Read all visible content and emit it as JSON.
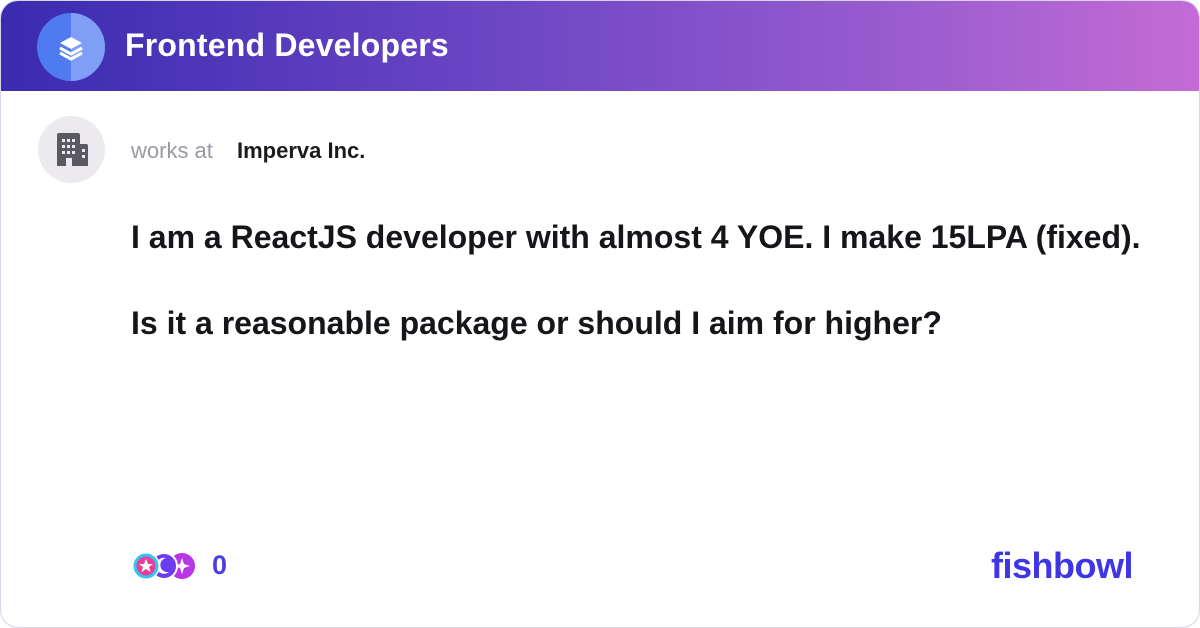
{
  "header": {
    "group_title": "Frontend Developers",
    "logo_icon": "layers-icon"
  },
  "author": {
    "avatar_icon": "building-icon",
    "works_at_label": "works at",
    "company": "Imperva Inc."
  },
  "post": {
    "line1": "I am a ReactJS developer with almost 4 YOE. I make 15LPA (fixed).",
    "line2": "Is it a reasonable package or should I aim for higher?"
  },
  "footer": {
    "reaction_icons": [
      "star-reaction-icon",
      "moon-reaction-icon",
      "sparkle-reaction-icon"
    ],
    "reaction_count": "0",
    "brand": "fishbowl"
  },
  "colors": {
    "header_gradient_start": "#3a2bb0",
    "header_gradient_end": "#c46bd6",
    "accent": "#3d35e6",
    "reaction_count": "#4b3ee0"
  }
}
